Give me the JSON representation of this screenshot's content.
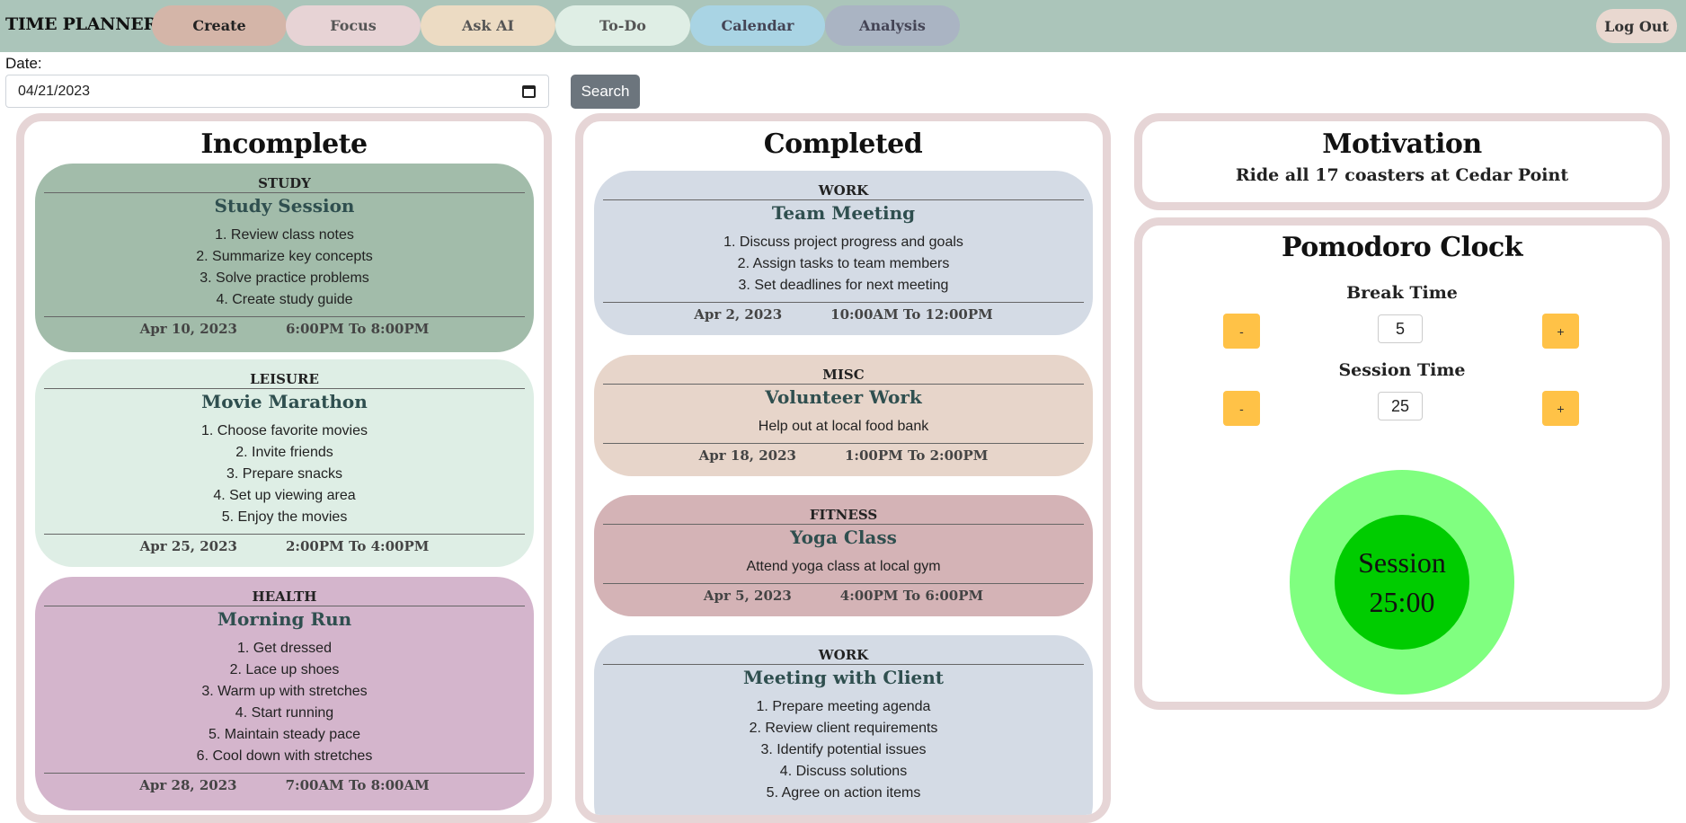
{
  "app": {
    "title": "TIME PLANNER",
    "logout_label": "Log Out"
  },
  "nav": [
    {
      "label": "Create",
      "color": "#d4b5a8",
      "text_color": "#222"
    },
    {
      "label": "Focus",
      "color": "#e7d3d5",
      "text_color": "#555"
    },
    {
      "label": "Ask AI",
      "color": "#ecdbc3",
      "text_color": "#555"
    },
    {
      "label": "To-Do",
      "color": "#dfeee5",
      "text_color": "#555"
    },
    {
      "label": "Calendar",
      "color": "#a9d4e4",
      "text_color": "#445"
    },
    {
      "label": "Analysis",
      "color": "#aab4c3",
      "text_color": "#445"
    }
  ],
  "date_filter": {
    "label": "Date:",
    "value": "04/21/2023",
    "search_label": "Search"
  },
  "incomplete": {
    "title": "Incomplete",
    "tasks": [
      {
        "category": "STUDY",
        "name": "Study Session",
        "steps": [
          "1. Review class notes",
          "2. Summarize key concepts",
          "3. Solve practice problems",
          "4. Create study guide"
        ],
        "date": "Apr 10, 2023",
        "time": "6:00PM To 8:00PM",
        "color": "#a2bcaa"
      },
      {
        "category": "LEISURE",
        "name": "Movie Marathon",
        "steps": [
          "1. Choose favorite movies",
          "2. Invite friends",
          "3. Prepare snacks",
          "4. Set up viewing area",
          "5. Enjoy the movies"
        ],
        "date": "Apr 25, 2023",
        "time": "2:00PM To 4:00PM",
        "color": "#deeee5"
      },
      {
        "category": "HEALTH",
        "name": "Morning Run",
        "steps": [
          "1. Get dressed",
          "2. Lace up shoes",
          "3. Warm up with stretches",
          "4. Start running",
          "5. Maintain steady pace",
          "6. Cool down with stretches"
        ],
        "date": "Apr 28, 2023",
        "time": "7:00AM To 8:00AM",
        "color": "#d4b5cc"
      }
    ]
  },
  "completed": {
    "title": "Completed",
    "tasks": [
      {
        "category": "WORK",
        "name": "Team Meeting",
        "steps": [
          "1. Discuss project progress and goals",
          "2. Assign tasks to team members",
          "3. Set deadlines for next meeting"
        ],
        "date": "Apr 2, 2023",
        "time": "10:00AM To 12:00PM",
        "color": "#d4dbe5"
      },
      {
        "category": "MISC",
        "name": "Volunteer Work",
        "steps": [
          "Help out at local food bank"
        ],
        "date": "Apr 18, 2023",
        "time": "1:00PM To 2:00PM",
        "color": "#e7d5ca"
      },
      {
        "category": "FITNESS",
        "name": "Yoga Class",
        "steps": [
          "Attend yoga class at local gym"
        ],
        "date": "Apr 5, 2023",
        "time": "4:00PM To 6:00PM",
        "color": "#d4b3b6"
      },
      {
        "category": "WORK",
        "name": "Meeting with Client",
        "steps": [
          "1. Prepare meeting agenda",
          "2. Review client requirements",
          "3. Identify potential issues",
          "4. Discuss solutions",
          "5. Agree on action items"
        ],
        "date": "",
        "time": "",
        "color": "#d4dbe5"
      }
    ]
  },
  "motivation": {
    "title": "Motivation",
    "text": "Ride all 17 coasters at Cedar Point"
  },
  "pomodoro": {
    "title": "Pomodoro Clock",
    "break_label": "Break Time",
    "break_value": "5",
    "session_label": "Session Time",
    "session_value": "25",
    "minus": "-",
    "plus": "+",
    "mode": "Session",
    "timer": "25:00"
  }
}
